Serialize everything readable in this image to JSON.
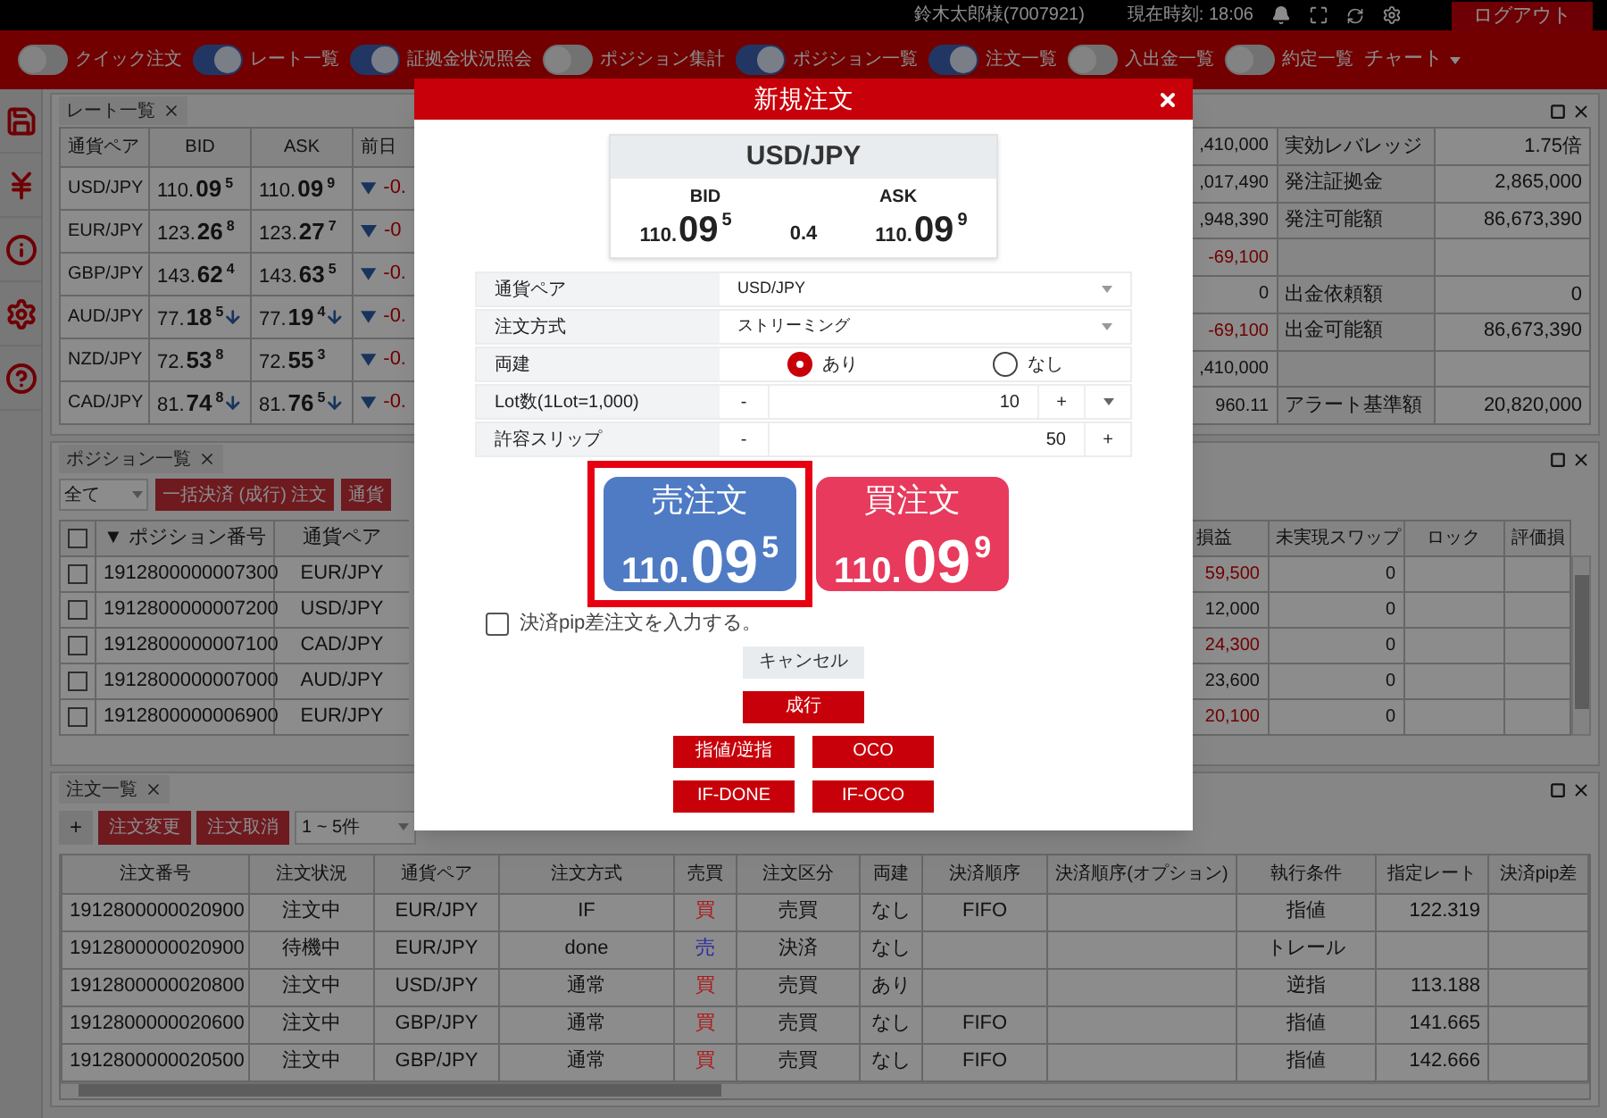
{
  "header": {
    "user": "鈴木太郎様(7007921)",
    "time": "現在時刻: 18:06",
    "logout": "ログアウト"
  },
  "nav": {
    "toggles": [
      {
        "label": "クイック注文",
        "on": false
      },
      {
        "label": "レート一覧",
        "on": true
      },
      {
        "label": "証拠金状況照会",
        "on": true
      },
      {
        "label": "ポジション集計",
        "on": false
      },
      {
        "label": "ポジション一覧",
        "on": true
      },
      {
        "label": "注文一覧",
        "on": true
      },
      {
        "label": "入出金一覧",
        "on": false
      },
      {
        "label": "約定一覧",
        "on": false
      }
    ],
    "chart": "チャート"
  },
  "rates": {
    "tab": "レート一覧",
    "columns": [
      "通貨ペア",
      "BID",
      "ASK",
      "前日"
    ],
    "rows": [
      {
        "pair": "USD/JPY",
        "bid": {
          "base": "110.",
          "pips": "09",
          "frac": "5"
        },
        "bid_down": false,
        "ask": {
          "base": "110.",
          "pips": "09",
          "frac": "9"
        },
        "ask_down": false,
        "change": "-0."
      },
      {
        "pair": "EUR/JPY",
        "bid": {
          "base": "123.",
          "pips": "26",
          "frac": "8"
        },
        "bid_down": false,
        "ask": {
          "base": "123.",
          "pips": "27",
          "frac": "7"
        },
        "ask_down": false,
        "change": "-0"
      },
      {
        "pair": "GBP/JPY",
        "bid": {
          "base": "143.",
          "pips": "62",
          "frac": "4"
        },
        "bid_down": false,
        "ask": {
          "base": "143.",
          "pips": "63",
          "frac": "5"
        },
        "ask_down": false,
        "change": "-0."
      },
      {
        "pair": "AUD/JPY",
        "bid": {
          "base": "77.",
          "pips": "18",
          "frac": "5"
        },
        "bid_down": true,
        "ask": {
          "base": "77.",
          "pips": "19",
          "frac": "4"
        },
        "ask_down": true,
        "change": "-0."
      },
      {
        "pair": "NZD/JPY",
        "bid": {
          "base": "72.",
          "pips": "53",
          "frac": "8"
        },
        "bid_down": false,
        "ask": {
          "base": "72.",
          "pips": "55",
          "frac": "3"
        },
        "ask_down": false,
        "change": "-0."
      },
      {
        "pair": "CAD/JPY",
        "bid": {
          "base": "81.",
          "pips": "74",
          "frac": "8"
        },
        "bid_down": true,
        "ask": {
          "base": "81.",
          "pips": "76",
          "frac": "5"
        },
        "ask_down": true,
        "change": "-0."
      }
    ]
  },
  "account": {
    "rows": [
      {
        "value_1": ",410,000",
        "negative": false,
        "label": "実効レバレッジ",
        "value_2": "1.75倍"
      },
      {
        "value_1": ",017,490",
        "negative": false,
        "label": "発注証拠金",
        "value_2": "2,865,000"
      },
      {
        "value_1": ",948,390",
        "negative": false,
        "label": "発注可能額",
        "value_2": "86,673,390"
      },
      {
        "value_1": "-69,100",
        "negative": true
      },
      {
        "value_1": "0",
        "negative": false,
        "label": "出金依頼額",
        "value_2": "0"
      },
      {
        "value_1": "-69,100",
        "negative": true,
        "label": "出金可能額",
        "value_2": "86,673,390"
      },
      {
        "value_1": ",410,000",
        "negative": false
      },
      {
        "value_1": "960.11",
        "negative": false,
        "label": "アラート基準額",
        "value_2": "20,820,000"
      }
    ]
  },
  "positions": {
    "tab": "ポジション一覧",
    "filter": "全て",
    "all_checked": false,
    "buttons": [
      "一括決済 (成行) 注文",
      "通貨"
    ],
    "columns_left": [
      "▼ ポジション番号",
      "通貨ペア"
    ],
    "columns_right": [
      "損益",
      "未実現スワップ",
      "ロック",
      "評価損"
    ],
    "rows": [
      {
        "checked": false,
        "number": "1912800000007300",
        "pair": "EUR/JPY",
        "pl": "59,500",
        "pl_negative": true,
        "swap": "0"
      },
      {
        "checked": false,
        "number": "1912800000007200",
        "pair": "USD/JPY",
        "pl": "12,000",
        "pl_negative": false,
        "swap": "0"
      },
      {
        "checked": false,
        "number": "1912800000007100",
        "pair": "CAD/JPY",
        "pl": "24,300",
        "pl_negative": true,
        "swap": "0"
      },
      {
        "checked": false,
        "number": "1912800000007000",
        "pair": "AUD/JPY",
        "pl": "23,600",
        "pl_negative": false,
        "swap": "0"
      },
      {
        "checked": false,
        "number": "1912800000006900",
        "pair": "EUR/JPY",
        "pl": "20,100",
        "pl_negative": true,
        "swap": "0"
      }
    ]
  },
  "orders": {
    "tab": "注文一覧",
    "add": "+",
    "buttons": [
      "注文変更",
      "注文取消"
    ],
    "page_size": "1 ~ 5件",
    "columns": [
      "注文番号",
      "注文状況",
      "通貨ペア",
      "注文方式",
      "売買",
      "注文区分",
      "両建",
      "決済順序",
      "決済順序(オプション)",
      "執行条件",
      "指定レート",
      "決済pip差"
    ],
    "rows": [
      {
        "number": "1912800000020900",
        "status": "注文中",
        "pair": "EUR/JPY",
        "method": "IF",
        "side": "買",
        "color": "#b01818",
        "category": "売買",
        "hedge": "なし",
        "settle": "FIFO",
        "condition": "指値",
        "rate": "122.319"
      },
      {
        "number": "1912800000020900",
        "status": "待機中",
        "pair": "EUR/JPY",
        "method": "done",
        "side": "売",
        "color": "#2a2aa0",
        "category": "決済",
        "hedge": "なし",
        "condition": "トレール"
      },
      {
        "number": "1912800000020800",
        "status": "注文中",
        "pair": "USD/JPY",
        "method": "通常",
        "side": "買",
        "color": "#b01818",
        "category": "売買",
        "hedge": "あり",
        "condition": "逆指",
        "rate": "113.188"
      },
      {
        "number": "1912800000020600",
        "status": "注文中",
        "pair": "GBP/JPY",
        "method": "通常",
        "side": "買",
        "color": "#b01818",
        "category": "売買",
        "hedge": "なし",
        "settle": "FIFO",
        "condition": "指値",
        "rate": "141.665"
      },
      {
        "number": "1912800000020500",
        "status": "注文中",
        "pair": "GBP/JPY",
        "method": "通常",
        "side": "買",
        "color": "#b01818",
        "category": "売買",
        "hedge": "なし",
        "settle": "FIFO",
        "condition": "指値",
        "rate": "142.666"
      }
    ]
  },
  "modal": {
    "title": "新規注文",
    "pair": "USD/JPY",
    "bid_label": "BID",
    "ask_label": "ASK",
    "bid": {
      "base": "110.",
      "pips": "09",
      "frac": "5"
    },
    "spread": "0.4",
    "ask": {
      "base": "110.",
      "pips": "09",
      "frac": "9"
    },
    "form": [
      {
        "kind": "select",
        "label": "通貨ペア",
        "value": "USD/JPY"
      },
      {
        "kind": "select",
        "label": "注文方式",
        "value": "ストリーミング"
      },
      {
        "kind": "radio",
        "label": "両建",
        "options": [
          {
            "label": "あり",
            "selected": true
          },
          {
            "label": "なし",
            "selected": false
          }
        ]
      },
      {
        "kind": "stepper",
        "label": "Lot数(1Lot=1,000)",
        "minus": "-",
        "value": "10",
        "plus": "+",
        "dropdown": true
      },
      {
        "kind": "stepper",
        "label": "許容スリップ",
        "minus": "-",
        "value": "50",
        "plus": "+",
        "dropdown": false
      }
    ],
    "sell": {
      "label": "売注文",
      "price": {
        "base": "110.",
        "pips": "09",
        "frac": "5"
      },
      "highlighted": true
    },
    "buy": {
      "label": "買注文",
      "price": {
        "base": "110.",
        "pips": "09",
        "frac": "9"
      }
    },
    "pip_checkbox": {
      "label": "決済pip差注文を入力する。",
      "checked": false
    },
    "cancel": "キャンセル",
    "market": "成行",
    "buttons": [
      "指値/逆指",
      "OCO",
      "IF-DONE",
      "IF-OCO"
    ]
  }
}
